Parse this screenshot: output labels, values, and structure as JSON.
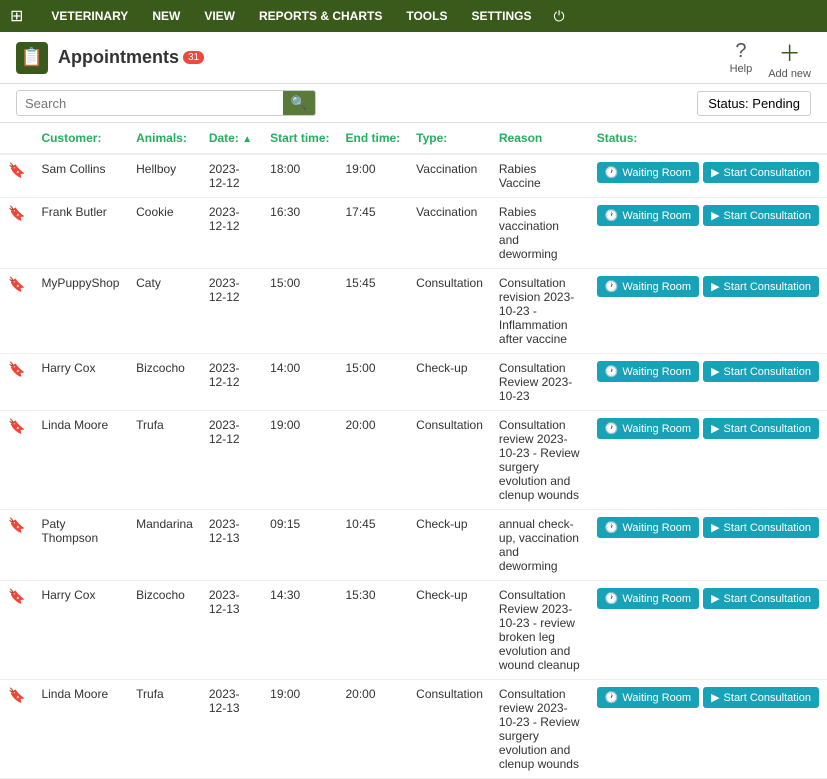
{
  "nav": {
    "items": [
      "VETERINARY",
      "NEW",
      "VIEW",
      "REPORTS & CHARTS",
      "TOOLS",
      "SETTINGS"
    ]
  },
  "header": {
    "title": "Appointments",
    "badge": "31",
    "help_label": "Help",
    "add_label": "Add new"
  },
  "toolbar": {
    "search_placeholder": "Search",
    "status_label": "Status:  Pending"
  },
  "table": {
    "columns": [
      "",
      "Customer:",
      "Animals:",
      "Date: ▲",
      "Start time:",
      "End time:",
      "Type:",
      "Reason",
      "Status:"
    ],
    "rows": [
      {
        "customer": "Sam Collins",
        "animal": "Hellboy",
        "date": "2023-12-12",
        "start": "18:00",
        "end": "19:00",
        "type": "Vaccination",
        "reason": "Rabies Vaccine",
        "status": ""
      },
      {
        "customer": "Frank Butler",
        "animal": "Cookie",
        "date": "2023-12-12",
        "start": "16:30",
        "end": "17:45",
        "type": "Vaccination",
        "reason": "Rabies vaccination and deworming",
        "status": ""
      },
      {
        "customer": "MyPuppyShop",
        "animal": "Caty",
        "date": "2023-12-12",
        "start": "15:00",
        "end": "15:45",
        "type": "Consultation",
        "reason": "Consultation revision 2023-10-23 - Inflammation after vaccine",
        "status": ""
      },
      {
        "customer": "Harry Cox",
        "animal": "Bizcocho",
        "date": "2023-12-12",
        "start": "14:00",
        "end": "15:00",
        "type": "Check-up",
        "reason": "Consultation Review 2023-10-23",
        "status": ""
      },
      {
        "customer": "Linda Moore",
        "animal": "Trufa",
        "date": "2023-12-12",
        "start": "19:00",
        "end": "20:00",
        "type": "Consultation",
        "reason": "Consultation review 2023-10-23 - Review surgery evolution and clenup wounds",
        "status": ""
      },
      {
        "customer": "Paty Thompson",
        "animal": "Mandarina",
        "date": "2023-12-13",
        "start": "09:15",
        "end": "10:45",
        "type": "Check-up",
        "reason": "annual check-up, vaccination and deworming",
        "status": ""
      },
      {
        "customer": "Harry Cox",
        "animal": "Bizcocho",
        "date": "2023-12-13",
        "start": "14:30",
        "end": "15:30",
        "type": "Check-up",
        "reason": "Consultation Review 2023-10-23 - review broken leg evolution and wound cleanup",
        "status": ""
      },
      {
        "customer": "Linda Moore",
        "animal": "Trufa",
        "date": "2023-12-13",
        "start": "19:00",
        "end": "20:00",
        "type": "Consultation",
        "reason": "Consultation review 2023-10-23 - Review surgery evolution and clenup wounds",
        "status": ""
      }
    ],
    "btn_waiting": "Waiting Room",
    "btn_start": "Start Consultation"
  }
}
